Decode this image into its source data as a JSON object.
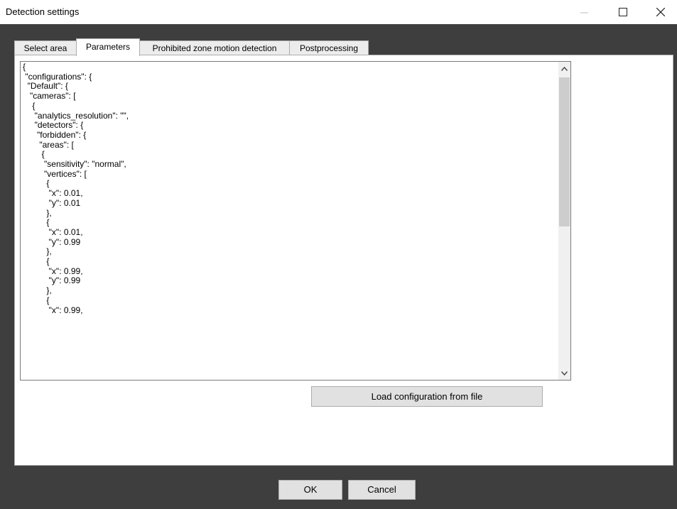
{
  "window": {
    "title": "Detection settings"
  },
  "tabs": [
    {
      "label": "Select area"
    },
    {
      "label": "Parameters"
    },
    {
      "label": "Prohibited zone motion detection"
    },
    {
      "label": "Postprocessing"
    }
  ],
  "editor": {
    "text": "{\n \"configurations\": {\n  \"Default\": {\n   \"cameras\": [\n    {\n     \"analytics_resolution\": \"\",\n     \"detectors\": {\n      \"forbidden\": {\n       \"areas\": [\n        {\n         \"sensitivity\": \"normal\",\n         \"vertices\": [\n          {\n           \"x\": 0.01,\n           \"y\": 0.01\n          },\n          {\n           \"x\": 0.01,\n           \"y\": 0.99\n          },\n          {\n           \"x\": 0.99,\n           \"y\": 0.99\n          },\n          {\n           \"x\": 0.99,"
  },
  "buttons": {
    "load": "Load configuration from file",
    "ok": "OK",
    "cancel": "Cancel"
  }
}
